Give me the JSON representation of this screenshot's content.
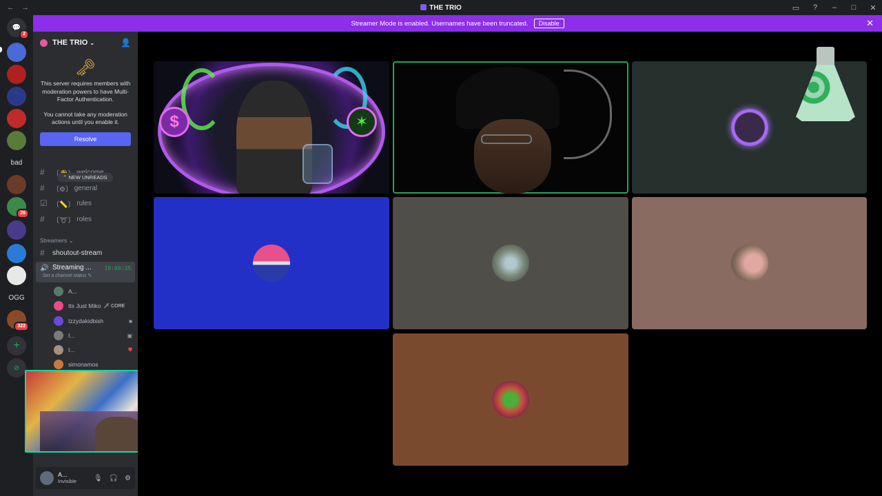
{
  "window": {
    "title": "THE TRIO",
    "controls": [
      "inbox-icon",
      "help-icon",
      "minimize-icon",
      "maximize-icon",
      "close-icon"
    ]
  },
  "rail": {
    "home_badge": "2",
    "text_server": "bad",
    "ogg_server": "OGG",
    "badge_26": "26",
    "badge_322": "322"
  },
  "banner": {
    "message": "Streamer Mode is enabled. Usernames have been truncated.",
    "disable_label": "Disable"
  },
  "sidebar": {
    "guild_name": "THE TRIO",
    "mfa_text_1": "This server requires members with moderation powers to have Multi-Factor Authentication.",
    "mfa_text_2": "You cannot take any moderation actions until you enable it.",
    "resolve_label": "Resolve",
    "new_unreads": "NEW UNREADS",
    "channels": [
      {
        "name": "welcome",
        "prefix": "〔👋〕"
      },
      {
        "name": "general",
        "prefix": "〔⚙〕"
      },
      {
        "name": "rules",
        "prefix": "〔📏〕"
      },
      {
        "name": "roles",
        "prefix": "〔➰〕"
      }
    ],
    "category": "Streamers",
    "shoutout": "shoutout-stream",
    "voice": {
      "name": "Streaming ...",
      "timer": "10:00:35",
      "status": "Set a channel status"
    },
    "members": [
      {
        "name": "A...",
        "color": "#5a7a6a"
      },
      {
        "name": "Its Just Miko",
        "tag": "CORE",
        "color": "#e94a8a"
      },
      {
        "name": "Izzydakidbish",
        "color": "#6a4ad8"
      },
      {
        "name": "I...",
        "color": "#7a7a7a"
      },
      {
        "name": "I...",
        "color": "#a89080"
      },
      {
        "name": "simonamos",
        "color": "#c87a3a"
      }
    ]
  },
  "user_panel": {
    "name": "A...",
    "status": "Invisible"
  },
  "stage": {
    "tiles": [
      {
        "id": "cam1",
        "kind": "camera",
        "bg": "#0d0d18"
      },
      {
        "id": "cam2",
        "kind": "camera",
        "bg": "#050505"
      },
      {
        "id": "user3",
        "kind": "avatar",
        "bg": "#26302c",
        "avatar": "#3a2a4a"
      },
      {
        "id": "user4",
        "kind": "avatar",
        "bg": "#2330c8",
        "avatar": "#e8508a"
      },
      {
        "id": "user5",
        "kind": "avatar",
        "bg": "#4f4e49",
        "avatar": "#7a8a7a"
      },
      {
        "id": "user6",
        "kind": "avatar",
        "bg": "#8a6b62",
        "avatar": "#d0a098"
      },
      {
        "id": "user7",
        "kind": "avatar",
        "bg": "#7a4a2e",
        "avatar": "#c87a3a"
      }
    ]
  }
}
